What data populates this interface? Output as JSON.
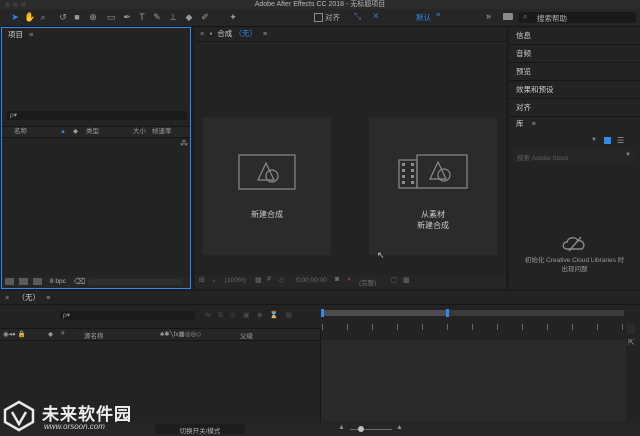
{
  "window": {
    "title": "Adobe After Effects CC 2018 - 无标题项目"
  },
  "toolbar": {
    "snap_label": "对齐",
    "workspace_label": "默认",
    "workspace_menu": "≡",
    "overflow": "»",
    "search_placeholder": "搜索帮助",
    "colors": {
      "accent": "#2d8ceb"
    }
  },
  "project": {
    "title": "项目",
    "menu": "≡",
    "search_icon": "ρ▾",
    "columns": [
      "名称",
      "类型",
      "大小",
      "帧速率"
    ],
    "bpc": "8 bpc"
  },
  "composition": {
    "close": "×",
    "title": "合成",
    "name": "（无）",
    "menu": "≡",
    "new_comp_label": "新建合成",
    "from_footage_label_line1": "从素材",
    "from_footage_label_line2": "新建合成",
    "zoom": "(100%)",
    "timecode": "0;00;00;00",
    "resolution": "(完整)"
  },
  "right_panels": {
    "items": [
      "信息",
      "音频",
      "预览",
      "效果和预设",
      "对齐"
    ],
    "library_title": "库",
    "library_menu": "≡",
    "library_search_placeholder": "搜索 Adobe Stock",
    "cc_message_line1": "初始化 Creative Cloud Libraries 时",
    "cc_message_line2": "出现问题"
  },
  "timeline": {
    "close": "×",
    "title": "（无）",
    "menu": "≡",
    "search_icon": "ρ▾",
    "col_name": "源名称",
    "col_parent": "父级",
    "col_hash": "#",
    "toggle_label": "切换开关/模式"
  },
  "watermark": {
    "brand": "未来软件园",
    "url": "www.orsoon.com"
  }
}
